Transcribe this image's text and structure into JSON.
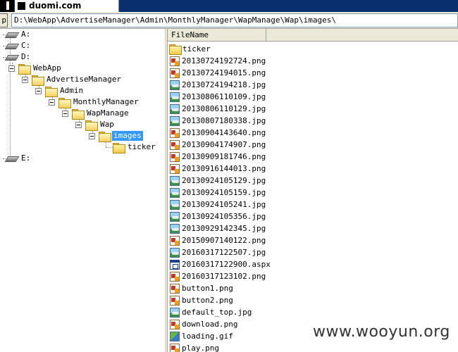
{
  "window": {
    "tab_title": "duomi.com",
    "button_partial": "p"
  },
  "address": {
    "path": "D:\\WebApp\\AdvertiseManager\\Admin\\MonthlyManager\\WapManage\\Wap\\images\\"
  },
  "tree": {
    "drives": [
      "A:",
      "C:",
      "D:",
      "E:"
    ],
    "folders": [
      "WebApp",
      "AdvertiseManager",
      "Admin",
      "MonthlyManager",
      "WapManage",
      "Wap",
      "images",
      "ticker"
    ],
    "selected": "images"
  },
  "file_list": {
    "column_header": "FileName",
    "files": [
      {
        "name": "ticker",
        "type": "folder"
      },
      {
        "name": "20130724192724.png",
        "type": "png"
      },
      {
        "name": "20130724194015.png",
        "type": "png"
      },
      {
        "name": "20130724194218.jpg",
        "type": "jpg"
      },
      {
        "name": "20130806110109.jpg",
        "type": "jpg"
      },
      {
        "name": "20130806110129.jpg",
        "type": "jpg"
      },
      {
        "name": "20130807180338.jpg",
        "type": "jpg"
      },
      {
        "name": "20130904143640.png",
        "type": "png"
      },
      {
        "name": "20130904174907.png",
        "type": "png"
      },
      {
        "name": "20130909181746.png",
        "type": "png"
      },
      {
        "name": "20130916144013.png",
        "type": "png"
      },
      {
        "name": "20130924105129.jpg",
        "type": "jpg"
      },
      {
        "name": "20130924105159.jpg",
        "type": "jpg"
      },
      {
        "name": "20130924105241.jpg",
        "type": "jpg"
      },
      {
        "name": "20130924105356.jpg",
        "type": "jpg"
      },
      {
        "name": "20130929142345.jpg",
        "type": "jpg"
      },
      {
        "name": "20150907140122.png",
        "type": "png"
      },
      {
        "name": "20160317122507.jpg",
        "type": "jpg"
      },
      {
        "name": "20160317122900.aspx",
        "type": "aspx"
      },
      {
        "name": "20160317123102.png",
        "type": "png"
      },
      {
        "name": "button1.png",
        "type": "png"
      },
      {
        "name": "button2.png",
        "type": "png"
      },
      {
        "name": "default_top.jpg",
        "type": "jpg"
      },
      {
        "name": "download.png",
        "type": "png"
      },
      {
        "name": "loading.gif",
        "type": "gif"
      },
      {
        "name": "play.png",
        "type": "png"
      }
    ]
  },
  "watermark": "www.wooyun.org"
}
